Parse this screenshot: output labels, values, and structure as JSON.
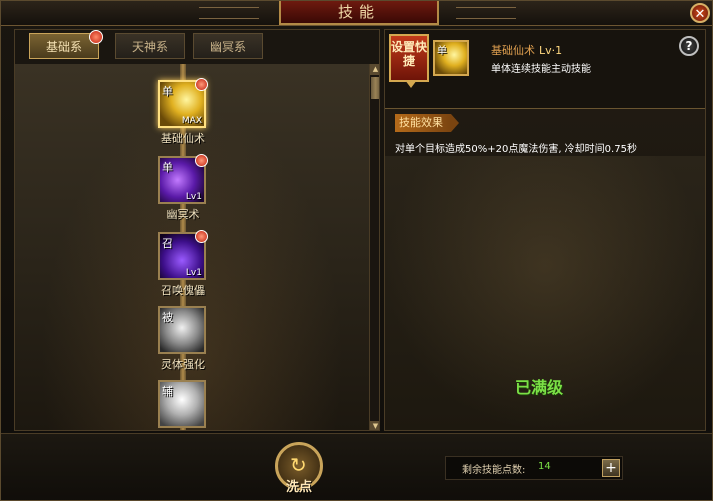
{
  "window": {
    "title": "技能",
    "close_icon": "close-icon"
  },
  "tabs": [
    {
      "label": "基础系",
      "active": true
    },
    {
      "label": "天神系",
      "active": false
    },
    {
      "label": "幽冥系",
      "active": false
    }
  ],
  "skills": [
    {
      "name": "基础仙术",
      "type": "单",
      "level": "MAX",
      "selected": true,
      "badge": true,
      "icon": "gold-wings-icon"
    },
    {
      "name": "幽冥术",
      "type": "单",
      "level": "Lv1",
      "selected": false,
      "badge": true,
      "icon": "purple-vortex-icon"
    },
    {
      "name": "召唤傀儡",
      "type": "召",
      "level": "Lv1",
      "selected": false,
      "badge": true,
      "icon": "puppet-icon"
    },
    {
      "name": "灵体强化",
      "type": "被",
      "level": "",
      "selected": false,
      "badge": false,
      "icon": "spirit-figure-icon"
    },
    {
      "name": "",
      "type": "辅",
      "level": "",
      "selected": false,
      "badge": false,
      "icon": "light-burst-icon"
    }
  ],
  "detail": {
    "set_shortcut": "设置快捷",
    "skill_type": "单",
    "skill_name": "基础仙术",
    "skill_level": "Lv·1",
    "skill_desc": "单体连续技能主动技能",
    "effect_tag": "技能效果",
    "effect_text": "对单个目标造成50%+20点魔法伤害, 冷却时间0.75秒",
    "status": "已满级",
    "help": "?"
  },
  "footer": {
    "reset_label": "洗点",
    "points_label": "剩余技能点数:",
    "points_value": "14",
    "plus": "+"
  },
  "colors": {
    "accent": "#d4a850",
    "maxed": "#7be046",
    "title_red": "#6e1a0f"
  }
}
